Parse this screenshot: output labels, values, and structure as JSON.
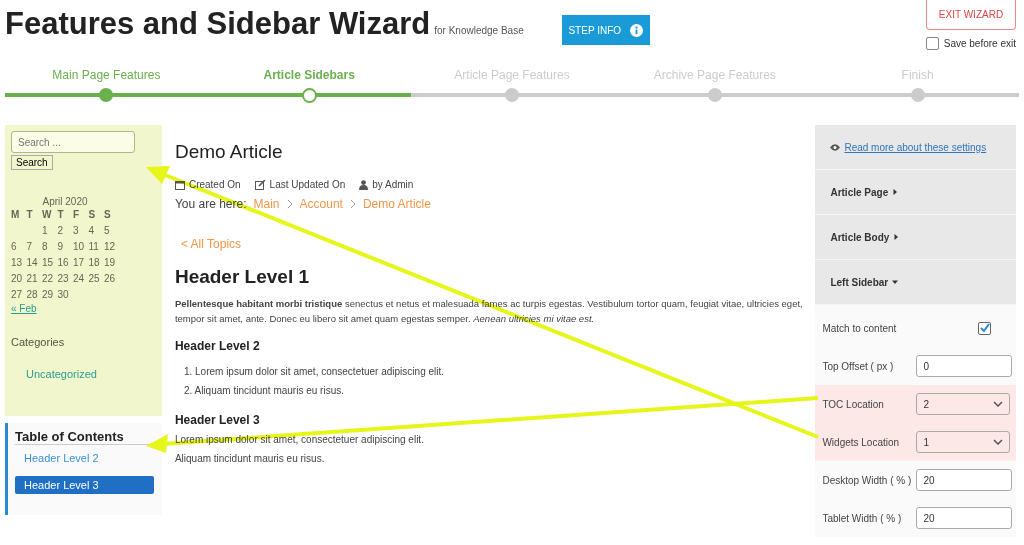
{
  "header": {
    "title": "Features and Sidebar Wizard",
    "subtitle": "for Knowledge Base",
    "step_info": "STEP INFO",
    "exit": "EXIT WIZARD",
    "save_before_exit": {
      "label": "Save before exit",
      "checked": false
    }
  },
  "steps": [
    {
      "label": "Main Page Features",
      "completed": true,
      "selected": false
    },
    {
      "label": "Article Sidebars",
      "completed": false,
      "selected": true
    },
    {
      "label": "Article Page Features",
      "completed": false,
      "selected": false
    },
    {
      "label": "Archive Page Features",
      "completed": false,
      "selected": false
    },
    {
      "label": "Finish",
      "completed": false,
      "selected": false
    }
  ],
  "sidebar": {
    "search": {
      "placeholder": "Search ...",
      "button": "Search"
    },
    "calendar": {
      "month": "April 2020",
      "weekdays": [
        "M",
        "T",
        "W",
        "T",
        "F",
        "S",
        "S"
      ],
      "weeks": [
        [
          "1",
          "2",
          "3",
          "4",
          "5"
        ],
        [
          "6",
          "7",
          "8",
          "9",
          "10",
          "11",
          "12"
        ],
        [
          "13",
          "14",
          "15",
          "16",
          "17",
          "18",
          "19"
        ],
        [
          "20",
          "21",
          "22",
          "23",
          "24",
          "25",
          "26"
        ],
        [
          "27",
          "28",
          "29",
          "30"
        ]
      ],
      "prev": "« Feb"
    },
    "categories": {
      "title": "Categories",
      "items": [
        "Uncategorized"
      ]
    },
    "toc": {
      "title": "Table of Contents",
      "items": [
        {
          "label": "Header Level 2",
          "selected": false
        },
        {
          "label": "Header Level 3",
          "selected": true
        }
      ]
    }
  },
  "article": {
    "title": "Demo Article",
    "meta": [
      {
        "kind": "calendar",
        "text": "Created On"
      },
      {
        "kind": "edit",
        "text": "Last Updated On"
      },
      {
        "kind": "user",
        "text": "by Admin"
      }
    ],
    "breadcrumb": {
      "label": "You are here:",
      "items": [
        "Main",
        "Account",
        "Demo Article"
      ]
    },
    "back": "< All Topics",
    "h1": "Header Level 1",
    "intro": "**Pellentesque habitant morbi tristique** senectus et netus et malesuada fames ac turpis egestas. Vestibulum tortor quam, feugiat vitae, ultricies eget, tempor sit amet, ante. Donec eu libero sit amet quam egestas semper. *Aenean ultricies mi vitae est.*",
    "h2": "Header Level 2",
    "list": [
      "1. Lorem ipsum dolor sit amet, consectetuer adipiscing elit.",
      "2. Aliquam tincidunt mauris eu risus."
    ],
    "h3": "Header Level 3",
    "paragraphs": [
      "Lorem ipsum dolor sit amet, consectetuer adipiscing elit.",
      "Aliquam tincidunt mauris eu risus."
    ]
  },
  "settings": {
    "link": "Read more about these settings",
    "sections": [
      {
        "label": "Article Page",
        "expanded": false
      },
      {
        "label": "Article Body",
        "expanded": false
      },
      {
        "label": "Left Sidebar",
        "expanded": true
      }
    ],
    "fields": [
      {
        "kind": "checkbox",
        "label": "Match to content",
        "checked": true,
        "highlighted": false
      },
      {
        "kind": "input",
        "label": "Top Offset ( px )",
        "value": "0",
        "highlighted": false
      },
      {
        "kind": "select",
        "label": "TOC Location",
        "value": "2",
        "highlighted": true
      },
      {
        "kind": "select",
        "label": "Widgets Location",
        "value": "1",
        "highlighted": true
      },
      {
        "kind": "input",
        "label": "Desktop Width ( % )",
        "value": "20",
        "highlighted": false
      },
      {
        "kind": "input",
        "label": "Tablet Width ( % )",
        "value": "20",
        "highlighted": false
      }
    ]
  }
}
